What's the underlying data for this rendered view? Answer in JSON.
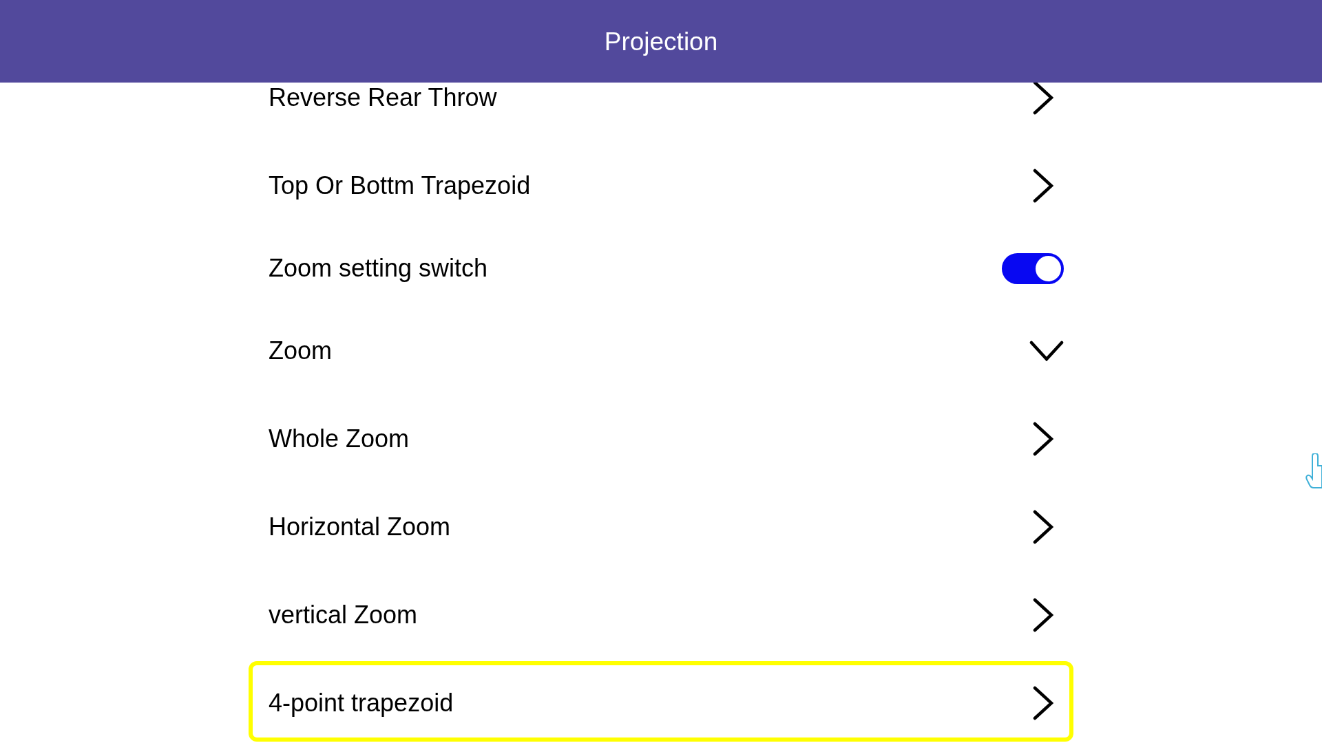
{
  "header": {
    "title": "Projection"
  },
  "items": [
    {
      "label": "Reverse Rear Throw",
      "kind": "link",
      "selected": false
    },
    {
      "label": "Top Or Bottm Trapezoid",
      "kind": "link",
      "selected": false
    },
    {
      "label": "Zoom setting switch",
      "kind": "switch",
      "on": true,
      "selected": false
    },
    {
      "label": "Zoom",
      "kind": "group",
      "expanded": true,
      "selected": false
    },
    {
      "label": "Whole Zoom",
      "kind": "link",
      "selected": false
    },
    {
      "label": "Horizontal Zoom",
      "kind": "link",
      "selected": false
    },
    {
      "label": "vertical Zoom",
      "kind": "link",
      "selected": false
    },
    {
      "label": "4-point trapezoid",
      "kind": "link",
      "selected": true
    }
  ]
}
